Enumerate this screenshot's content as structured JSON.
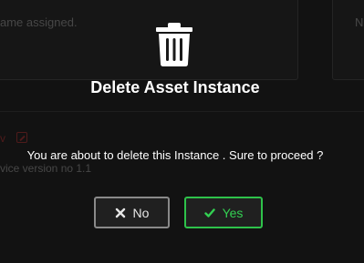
{
  "background": {
    "card_text": "ame assigned.",
    "right_card_text": "N",
    "v_label": "v",
    "version_text": "vice version no 1.1"
  },
  "modal": {
    "icon": "trash-icon",
    "title": "Delete Asset Instance",
    "message": "You are about to delete this Instance . Sure to proceed ?",
    "no_label": "No",
    "no_icon": "close-icon",
    "yes_label": "Yes",
    "yes_icon": "check-icon"
  },
  "colors": {
    "yes_accent": "#2ec24a",
    "no_border": "#8a8a8a",
    "background": "#1c1c1c"
  }
}
